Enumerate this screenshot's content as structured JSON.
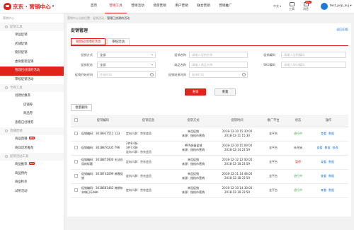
{
  "header": {
    "logo_text": "京东 · 营销中心",
    "brand_color": "#e2231a",
    "nav": [
      "首页",
      "营销工具",
      "营销活动",
      "场景营销",
      "用户营销",
      "联合营销",
      "营销推广"
    ],
    "active_nav": 1,
    "lang": "中文",
    "tools_label": "工具",
    "msg_label": "消息",
    "msg_badge": "99+",
    "username": "test_pop_auj"
  },
  "sidebar": {
    "breadcrumb": "营销中心",
    "items": [
      {
        "type": "section",
        "label": "促销工具"
      },
      {
        "type": "item",
        "label": "单品促销"
      },
      {
        "type": "item",
        "label": "店铺促销"
      },
      {
        "type": "item",
        "label": "套装促销"
      },
      {
        "type": "item",
        "label": "虚拟套装促销"
      },
      {
        "type": "item",
        "label": "管理已创建的活动",
        "active": true
      },
      {
        "type": "item",
        "label": "审核促销活动"
      },
      {
        "type": "section",
        "label": "卡券工具"
      },
      {
        "type": "item",
        "label": "创建优惠券"
      },
      {
        "type": "sub",
        "label": "店铺券"
      },
      {
        "type": "sub",
        "label": "商品券"
      },
      {
        "type": "item",
        "label": "查看已创建券"
      },
      {
        "type": "section",
        "label": "直播营销"
      },
      {
        "type": "item",
        "label": "商品直播",
        "new": "NEW"
      },
      {
        "type": "item",
        "label": "商详话术推荐"
      },
      {
        "type": "section",
        "label": "促销活动工具"
      },
      {
        "type": "item",
        "label": "商品推荐",
        "new": "NEW"
      },
      {
        "type": "item",
        "label": "商品预约"
      },
      {
        "type": "item",
        "label": "商品秒杀"
      },
      {
        "type": "item",
        "label": "试用活动"
      }
    ]
  },
  "breadcrumb": {
    "prefix": "营销中心当前位置：",
    "path": "促销活动 › ",
    "current": "管理已创建的活动"
  },
  "page": {
    "title": "促销管理",
    "back_link": "返回旧版"
  },
  "tabs": [
    {
      "label": "管理已创建的活动",
      "active": true
    },
    {
      "label": "审核活动"
    }
  ],
  "filters": {
    "promo_type_label": "促销方式",
    "promo_type_value": "全部",
    "promo_status_label": "促销状态",
    "promo_status_value": "全部",
    "start_time_label": "促销开始时间",
    "start_time_placeholder": "开始时间",
    "name_label": "促销名称",
    "name_placeholder": "请输入促销名称",
    "sku_name_label": "商品名称",
    "sku_name_placeholder": "请输入商品名称",
    "end_time_label": "促销结束时间",
    "end_time_placeholder": "结束时间",
    "id_label": "促销编码",
    "id_placeholder": "请输入促销编码",
    "sku_label": "SKU编码",
    "sku_placeholder": "请输入SKU编码",
    "search_btn": "查询",
    "reset_btn": "重置"
  },
  "batch_delete": "批量删除",
  "table": {
    "headers": [
      "",
      "促销编码",
      "促销信息",
      "促销方式",
      "促销时间",
      "推广平台",
      "状态",
      "操作"
    ],
    "rows": [
      {
        "code": "促销编码：3018927512 123",
        "info": "定向人群：京东会员",
        "type": "单品促销\n来源：指档市营销",
        "time": "2018-12-10 15:30:00\n2018-12-11 15:30",
        "platform": "全平台",
        "status": "进行中",
        "status_color": "#2da641",
        "ops": [
          "查看",
          "数据"
        ]
      },
      {
        "code": "促销编码：3018876235 796",
        "info": "2件8.0折\n3件7.0折\n定向人群：京东会员",
        "type": "MFN多级促销\n来源：指档市营销",
        "time": "2018-12-10 15:09:00\n2018-12-14 23:59",
        "platform": "全平台",
        "status": "未开始",
        "status_color": "#333333",
        "ops": [
          "查看",
          "数据",
          "修改"
        ]
      },
      {
        "code": "促销编码：3018871900 无法应用的标题",
        "info": "定向人群：京东会员",
        "type": "单品促销\n来源：指档市营销",
        "time": "2018-12-12 12:00:00\n2018-12-18 23:59",
        "platform": "全平台",
        "status": "暂停",
        "status_color": "#e2231a",
        "ops": [
          "查看",
          "数据"
        ]
      },
      {
        "code": "促销编码：3018741099 新春促销",
        "info": "定向人群：京东会员",
        "type": "单品促销\n来源：指档市营销",
        "time": "2018-12-11 14:48:00\n2018-12-18 23:59",
        "platform": "全平台",
        "status": "进行中",
        "status_color": "#2da641",
        "ops": [
          "查看",
          "数据"
        ]
      },
      {
        "code": "促销编码：3018681462 跨期年末嗨日乐bbb",
        "info": "定向人群：京东会员",
        "type": "单品促销\n来源：指档市营销",
        "time": "2018-12-10 14:30:00\n2018-12-18 23:59",
        "platform": "全平台",
        "status": "进行中",
        "status_color": "#2da641",
        "ops": [
          "查看",
          "数据"
        ]
      }
    ]
  }
}
